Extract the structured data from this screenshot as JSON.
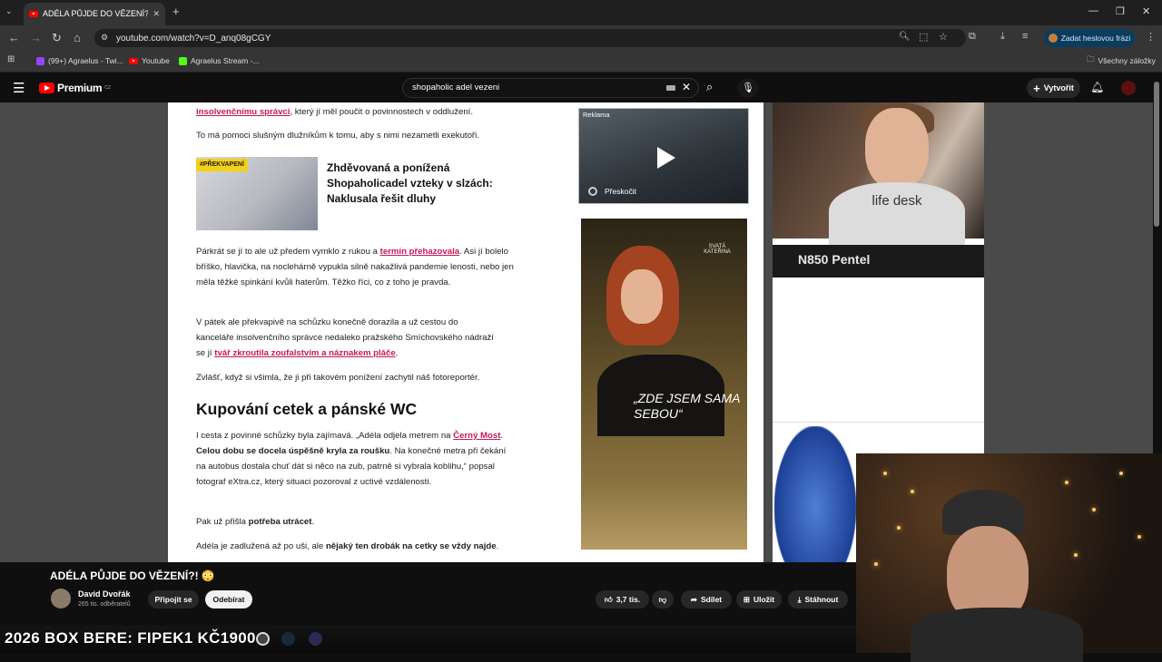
{
  "browser": {
    "tab_title": "ADÉLA PŮJDE DO VĚZENÍ?! 😳",
    "url": "youtube.com/watch?v=D_anq08gCGY",
    "password_button": "Zadat heslovou frázi",
    "bookmarks": [
      {
        "label": "(99+) Agraelus - Twi...",
        "color": "#9146ff"
      },
      {
        "label": "Youtube",
        "color": "#ff0000"
      },
      {
        "label": "Agraelus Stream -...",
        "color": "#53fc18"
      }
    ],
    "all_bookmarks": "Všechny záložky"
  },
  "youtube": {
    "logo": "Premium",
    "logo_sup": "CZ",
    "search_query": "shopaholic adel vezeni",
    "create_label": "Vytvořit"
  },
  "article": {
    "p_top": "insolvenčnímu správci, který jí měl poučit o povinnostech v oddlužení.",
    "p_top_link": "insolvenčnímu správci",
    "p_top_rest": ", který jí měl poučit o povinnostech v oddlužení.",
    "p2": "To má pomoci slušným dlužníkům k tomu, aby s nimi nezametli exekutoři.",
    "tag": "#PŘEKVAPENÍ",
    "teaser": "Zhděvovaná a ponížená Shopaholicadel vzteky v slzách: Naklusala řešit dluhy",
    "p3a": "Párkrát se jí to ale už předem vymklo z rukou a ",
    "p3_link": "termín přehazovala",
    "p3b": ". Asi jí bolelo bříško, hlavička, na noclehárně vypukla silně nakažlivá pandemie lenosti, nebo jen měla těžké spinkání kvůli haterům. Těžko říci, co z toho je pravda.",
    "p4a": "V pátek ale překvapivě na schůzku konečně dorazila a už cestou do kanceláře insolvenčního správce nedaleko pražského Smíchovského nádraží se jí ",
    "p4_link": "tvář zkroutila zoufalstvím a náznakem pláče",
    "p4b": ".",
    "p5": "Zvlášť, když si všimla, že ji při takovém ponížení zachytil náš fotoreportér.",
    "h2": "Kupování cetek a pánské WC",
    "p6a": "I cesta z povinné schůzky byla zajímavá. „Adéla odjela metrem na ",
    "p6_link": "Černý Most",
    "p6b": ". ",
    "p6_bold": "Celou dobu se docela úspěšně kryla za roušku",
    "p6c": ". Na konečné metra při čekání na autobus dostala chuť dát si něco na zub, patrně si vybrala koblihu,“ popsal fotograf eXtra.cz, který situaci pozoroval z uctivé vzdálenosti.",
    "p7a": "Pak už přišla ",
    "p7_bold": "potřeba utrácet",
    "p7b": ".",
    "p8a": "Adéla je zadlužená až po uši, ale ",
    "p8_bold": "nějaký ten drobák na cetky se vždy najde",
    "p8b": ".",
    "ad1_label": "Reklama",
    "ad1_skip": "Přeskočit",
    "ad2_quote": "„ZDE JSEM SAMA SEBOU“",
    "ad2_brand": "SVATÁ KATEŘINA",
    "pentel": "N850 Pentel",
    "hoodie": "life desk"
  },
  "video": {
    "title": "ADÉLA PŮJDE DO VĚZENÍ?! 😳",
    "channel": "David Dvořák",
    "subscribers": "265 tis. odběratelů",
    "join": "Připojit se",
    "subscribe": "Odebírat",
    "likes": "3,7 tis.",
    "share": "Sdílet",
    "save": "Uložit",
    "download": "Stáhnout"
  },
  "overlay": {
    "promo": "2026 BOX BERE: FIPEK1 KČ1900"
  }
}
